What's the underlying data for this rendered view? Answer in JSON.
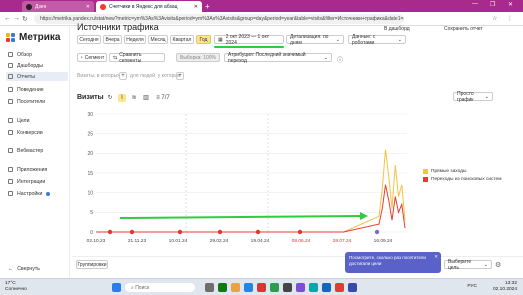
{
  "browser": {
    "tabs": [
      {
        "label": "Дзен",
        "active": false
      },
      {
        "label": "Счетчики в Яндекс для абзац",
        "active": true
      }
    ],
    "url": "https://metrika.yandex.ru/stat/new?metric=ym%3As%3Avisits&period=ym%3As%3Avisits&group=day&period=year&table=visits&filter=Источники+трафика&date1=2023",
    "new_tab": "+"
  },
  "sidebar": {
    "logo": "Метрика",
    "items": [
      {
        "label": "Обзор"
      },
      {
        "label": "Дашборды"
      },
      {
        "label": "Отчеты"
      },
      {
        "label": "Поведение"
      },
      {
        "label": "Посетители"
      },
      {
        "label": "Цели"
      },
      {
        "label": "Конверсии"
      },
      {
        "label": "Вебмастер"
      },
      {
        "label": "Приложения"
      },
      {
        "label": "Интеграции"
      },
      {
        "label": "Настройки"
      }
    ],
    "collapse": "Свернуть"
  },
  "main": {
    "title": "Источники трафика",
    "top_right": {
      "goto": "В дашборд",
      "save": "Сохранить отчет"
    },
    "periods": [
      "Сегодня",
      "Вчера",
      "Неделя",
      "Месяц",
      "Квартал",
      "Год"
    ],
    "date_range": "2 окт 2023 — 1 окт 2024",
    "detail": "Детализация: по дням",
    "data_src": "Данные: с роботами",
    "segment": "Сегмент",
    "compare": "Сравнить сегменты",
    "sample": "Выборка: 100%",
    "attribution": "Атрибуция: Последний значимый переход",
    "filter_hint": "Визиты, в которых",
    "filter_hint2": "для людей, у которых",
    "chart_title": "Визиты",
    "count_label": "7/7",
    "graph_type": "Просто график",
    "legend": [
      {
        "label": "Прямые заходы",
        "color": "#f6c242"
      },
      {
        "label": "Переходы из поисковых систем",
        "color": "#e63d2f"
      }
    ],
    "grouping": "Группировки",
    "select_goal": "Выберите цель",
    "tooltip": "Посмотрите, сколько раз посетители достигали цели"
  },
  "chart_data": {
    "type": "line",
    "title": "",
    "ylim": [
      0,
      30
    ],
    "yticks": [
      0,
      5,
      10,
      15,
      20,
      25,
      30
    ],
    "xticks": [
      "02.10.23",
      "21.11.23",
      "10.01.24",
      "29.02.24",
      "19.04.24",
      "08.06.24",
      "28.07.24",
      "16.09.24"
    ],
    "xticks_red": [
      false,
      false,
      false,
      false,
      false,
      true,
      true,
      false
    ],
    "series": [
      {
        "name": "Прямые заходы",
        "color": "#f6c242",
        "values": [
          0,
          0,
          0,
          0,
          0,
          0,
          0,
          0,
          4,
          11,
          21,
          14,
          6,
          17,
          9,
          12,
          3
        ]
      },
      {
        "name": "Переходы из поисковых систем",
        "color": "#e63d2f",
        "values": [
          0,
          0,
          0,
          0,
          0,
          0,
          0,
          0,
          2,
          6,
          12,
          8,
          3,
          9,
          5,
          7,
          1
        ]
      }
    ],
    "grid": true
  },
  "taskbar": {
    "weather_temp": "17°C",
    "weather_desc": "Солнечно",
    "search": "Поиск",
    "time": "13:32",
    "date": "02.10.2024",
    "lang": "РУС"
  }
}
